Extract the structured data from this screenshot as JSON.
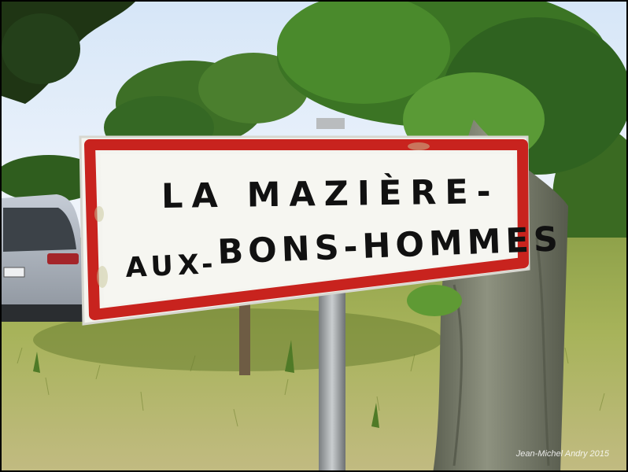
{
  "sign": {
    "line1": "LA MAZIÈRE-",
    "line2a": "AUX-",
    "line2b": "BONS-HOMMES",
    "border_color": "#c8231e",
    "panel_color": "#f4f4ef"
  },
  "credit": "Jean-Michel Andry 2015",
  "scene_elements": {
    "sky_color": "#e8f1fa",
    "grass_color": "#9fae4c",
    "tree_foliage_color": "#3f7a25"
  }
}
